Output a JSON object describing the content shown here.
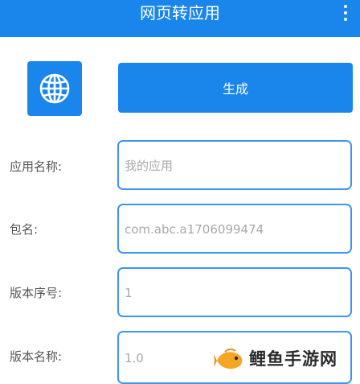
{
  "app_bar": {
    "title": "网页转应用",
    "overflow_icon": "more-vert-icon",
    "color": "#1a86ec"
  },
  "app_icon": {
    "icon": "globe-icon"
  },
  "generate_button": {
    "label": "生成"
  },
  "form": {
    "app_name": {
      "label": "应用名称:",
      "value": "",
      "placeholder": "我的应用"
    },
    "package_name": {
      "label": "包名:",
      "value": "",
      "placeholder": "com.abc.a1706099474"
    },
    "version_code": {
      "label": "版本序号:",
      "value": "",
      "placeholder": "1"
    },
    "version_name": {
      "label": "版本名称:",
      "value": "",
      "placeholder": "1.0"
    }
  },
  "watermark": {
    "text": "鲤鱼手游网",
    "icon": "fish-logo-icon"
  }
}
